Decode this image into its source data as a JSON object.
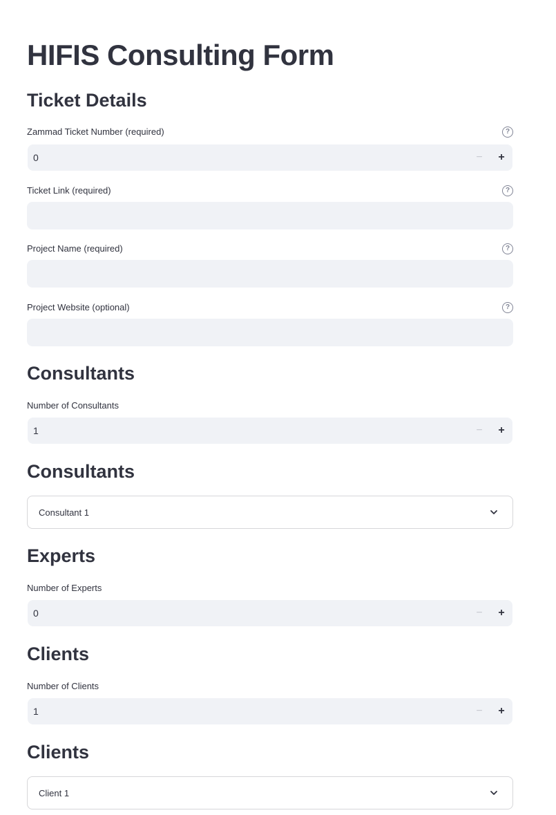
{
  "page_title": "HIFIS Consulting Form",
  "ticket_details": {
    "heading": "Ticket Details",
    "zammad_ticket": {
      "label": "Zammad Ticket Number (required)",
      "value": "0",
      "minus": "−",
      "plus": "+"
    },
    "ticket_link": {
      "label": "Ticket Link (required)",
      "value": ""
    },
    "project_name": {
      "label": "Project Name (required)",
      "value": ""
    },
    "project_website": {
      "label": "Project Website (optional)",
      "value": ""
    },
    "help_glyph": "?"
  },
  "consultants": {
    "heading": "Consultants",
    "count_label": "Number of Consultants",
    "count_value": "1",
    "minus": "−",
    "plus": "+",
    "list_heading": "Consultants",
    "expanders": [
      "Consultant 1"
    ]
  },
  "experts": {
    "heading": "Experts",
    "count_label": "Number of Experts",
    "count_value": "0",
    "minus": "−",
    "plus": "+"
  },
  "clients": {
    "heading": "Clients",
    "count_label": "Number of Clients",
    "count_value": "1",
    "minus": "−",
    "plus": "+",
    "list_heading": "Clients",
    "expanders": [
      "Client 1"
    ]
  },
  "icons": {
    "help": "help-circle-icon",
    "expand": "chevron-down-icon"
  },
  "colors": {
    "text": "#31333f",
    "input_bg": "#f0f2f6",
    "border": "#d6d6d9",
    "muted": "#808495"
  }
}
